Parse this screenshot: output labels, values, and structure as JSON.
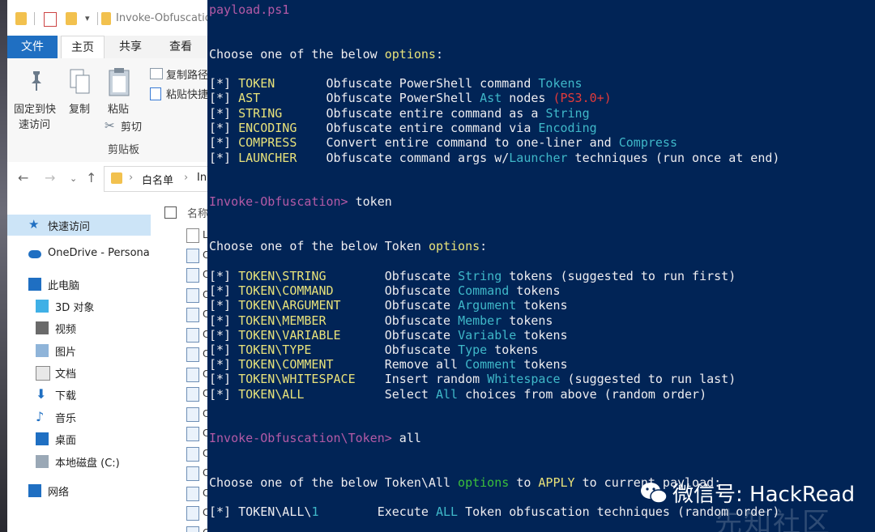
{
  "explorer": {
    "title": "Invoke-Obfuscatio",
    "tabs": {
      "file": "文件",
      "home": "主页",
      "share": "共享",
      "view": "查看"
    },
    "ribbon": {
      "pin_line1": "固定到快",
      "pin_line2": "速访问",
      "copy": "复制",
      "paste": "粘贴",
      "copy_path": "复制路径",
      "paste_shortcut": "粘贴快捷",
      "cut": "剪切",
      "group_clipboard": "剪贴板"
    },
    "address": {
      "crumb1": "白名单",
      "crumb_sep": "›",
      "crumb2": "In"
    },
    "column_header": "名称",
    "sidebar": [
      {
        "label": "快速访问",
        "icon": "star-icon"
      },
      {
        "label": "OneDrive - Persona",
        "icon": "cloud-icon"
      },
      {
        "label": "此电脑",
        "icon": "computer-icon"
      },
      {
        "label": "3D 对象",
        "icon": "cube-icon"
      },
      {
        "label": "视频",
        "icon": "video-icon"
      },
      {
        "label": "图片",
        "icon": "picture-icon"
      },
      {
        "label": "文档",
        "icon": "document-icon"
      },
      {
        "label": "下载",
        "icon": "download-icon"
      },
      {
        "label": "音乐",
        "icon": "music-icon"
      },
      {
        "label": "桌面",
        "icon": "desktop-icon"
      },
      {
        "label": "本地磁盘 (C:)",
        "icon": "disk-icon"
      },
      {
        "label": "网络",
        "icon": "network-icon"
      }
    ],
    "file_initials": [
      "L",
      "C",
      "C",
      "C",
      "C",
      "C",
      "C",
      "C",
      "C",
      "C",
      "C",
      "C",
      "C",
      "C",
      "C",
      "C"
    ]
  },
  "terminal": {
    "top_line": "payload.ps1",
    "choose1_prefix": "Choose one of the below ",
    "choose1_opt": "options",
    "choose1_suffix": ":",
    "menu1": [
      {
        "bullet": "[*] ",
        "name": "TOKEN",
        "pad": "       ",
        "desc": "Obfuscate PowerShell command ",
        "hl": "Tokens",
        "extra": ""
      },
      {
        "bullet": "[*] ",
        "name": "AST",
        "pad": "         ",
        "desc": "Obfuscate PowerShell ",
        "hl": "Ast",
        "tail": " nodes ",
        "extra": "(PS3.0+)"
      },
      {
        "bullet": "[*] ",
        "name": "STRING",
        "pad": "      ",
        "desc": "Obfuscate entire command as a ",
        "hl": "String",
        "extra": ""
      },
      {
        "bullet": "[*] ",
        "name": "ENCODING",
        "pad": "    ",
        "desc": "Obfuscate entire command via ",
        "hl": "Encoding",
        "extra": ""
      },
      {
        "bullet": "[*] ",
        "name": "COMPRESS",
        "pad": "    ",
        "desc": "Convert entire command to one-liner and ",
        "hl": "Compress",
        "extra": ""
      },
      {
        "bullet": "[*] ",
        "name": "LAUNCHER",
        "pad": "    ",
        "desc": "Obfuscate command args w/",
        "hl": "Launcher",
        "tail": " techniques (run once at end)",
        "extra": ""
      }
    ],
    "prompt1": "Invoke-Obfuscation>",
    "cmd1": " token",
    "choose2_prefix": "Choose one of the below Token ",
    "choose2_opt": "options",
    "choose2_suffix": ":",
    "menu2": [
      {
        "name": "TOKEN\\STRING",
        "desc": "Obfuscate ",
        "hl": "String",
        "tail": " tokens (suggested to run first)"
      },
      {
        "name": "TOKEN\\COMMAND",
        "desc": "Obfuscate ",
        "hl": "Command",
        "tail": " tokens"
      },
      {
        "name": "TOKEN\\ARGUMENT",
        "desc": "Obfuscate ",
        "hl": "Argument",
        "tail": " tokens"
      },
      {
        "name": "TOKEN\\MEMBER",
        "desc": "Obfuscate ",
        "hl": "Member",
        "tail": " tokens"
      },
      {
        "name": "TOKEN\\VARIABLE",
        "desc": "Obfuscate ",
        "hl": "Variable",
        "tail": " tokens"
      },
      {
        "name": "TOKEN\\TYPE",
        "desc": "Obfuscate ",
        "hl": "Type",
        "tail": " tokens"
      },
      {
        "name": "TOKEN\\COMMENT",
        "desc": "Remove all ",
        "hl": "Comment",
        "tail": " tokens"
      },
      {
        "name": "TOKEN\\WHITESPACE",
        "desc": "Insert random ",
        "hl": "Whitespace",
        "tail": " (suggested to run last)"
      },
      {
        "name": "TOKEN\\ALL",
        "desc": "Select ",
        "hl": "All",
        "tail": " choices from above (random order)"
      }
    ],
    "prompt2": "Invoke-Obfuscation\\Token>",
    "cmd2": " all",
    "choose3_prefix": "Choose one of the below Token\\All ",
    "choose3_opt": "options",
    "choose3_mid": " to ",
    "choose3_apply": "APPLY",
    "choose3_suffix": " to current payload:",
    "final_bullet": "[*] ",
    "final_name": "TOKEN\\ALL\\",
    "final_num": "1",
    "final_desc": "Execute ",
    "final_hl": "ALL",
    "final_tail": " Token obfuscation techniques (random order)"
  },
  "watermark": {
    "text": "微信号: HackRead",
    "ghost": "先知社区"
  },
  "colors": {
    "terminal_bg": "#012456",
    "accent_blue": "#1f6fc2",
    "sel_blue": "#cce4f7"
  }
}
